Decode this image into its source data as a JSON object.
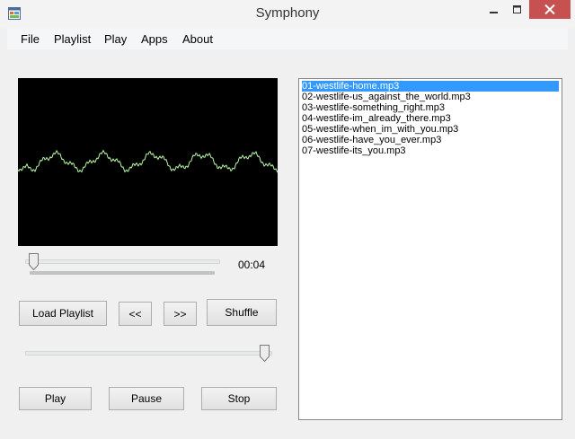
{
  "window": {
    "title": "Symphony",
    "close_color": "#c75050"
  },
  "menu": {
    "file": "File",
    "playlist": "Playlist",
    "play": "Play",
    "apps": "Apps",
    "about": "About"
  },
  "player": {
    "time": "00:04",
    "seek_position": 0.02,
    "volume": 1.0,
    "visualizer_color": "#b6f7a4"
  },
  "buttons": {
    "load_playlist": "Load Playlist",
    "previous": "<<",
    "next": ">>",
    "shuffle": "Shuffle",
    "play": "Play",
    "pause": "Pause",
    "stop": "Stop"
  },
  "playlist": {
    "selected_index": 0,
    "selected_color": "#3399ff",
    "items": [
      "01-westlife-home.mp3",
      "02-westlife-us_against_the_world.mp3",
      "03-westlife-something_right.mp3",
      "04-westlife-im_already_there.mp3",
      "05-westlife-when_im_with_you.mp3",
      "06-westlife-have_you_ever.mp3",
      "07-westlife-its_you.mp3"
    ]
  }
}
